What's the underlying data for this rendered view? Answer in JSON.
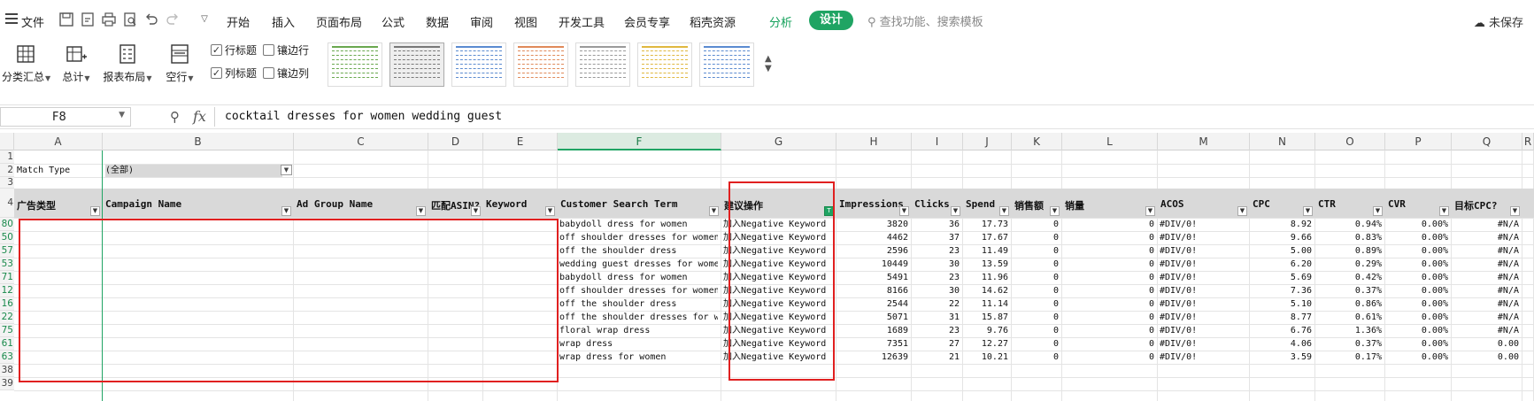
{
  "menubar": {
    "file": "文件",
    "tabs": [
      "开始",
      "插入",
      "页面布局",
      "公式",
      "数据",
      "审阅",
      "视图",
      "开发工具",
      "会员专享",
      "稻壳资源"
    ],
    "analyze": "分析",
    "design": "设计",
    "search_placeholder": "查找功能、搜索模板",
    "unsaved": "未保存"
  },
  "ribbon": {
    "subtotal": "分类汇总",
    "grand_total": "总计",
    "report_layout": "报表布局",
    "blank_rows": "空行",
    "row_headers": "行标题",
    "banded_rows": "镶边行",
    "col_headers": "列标题",
    "banded_cols": "镶边列",
    "row_headers_checked": true,
    "col_headers_checked": true,
    "style_colors": [
      "#6aa84f",
      "#777777",
      "#5b8bd0",
      "#e08a5a",
      "#9a9a9a",
      "#e0b840",
      "#5b8bd0"
    ]
  },
  "formulabar": {
    "cell_ref": "F8",
    "fx": "fx",
    "value": "cocktail dresses for women wedding guest"
  },
  "sheet": {
    "columns": [
      "A",
      "B",
      "C",
      "D",
      "E",
      "F",
      "G",
      "H",
      "I",
      "J",
      "K",
      "L",
      "M",
      "N",
      "O",
      "P",
      "Q",
      "R"
    ],
    "active_column": "F",
    "filter_label": "Match Type",
    "filter_value": "(全部)",
    "headers": [
      "广告类型",
      "Campaign Name",
      "Ad Group Name",
      "匹配ASIN?",
      "Keyword",
      "Customer Search Term",
      "建议操作",
      "Impressions",
      "Clicks",
      "Spend",
      "销售额",
      "销量",
      "ACOS",
      "CPC",
      "CTR",
      "CVR",
      "目标CPC?"
    ],
    "top_rows": [
      "1",
      "2",
      "3",
      "4"
    ],
    "data_row_labels": [
      "80",
      "50",
      "57",
      "53",
      "71",
      "12",
      "16",
      "22",
      "75",
      "61",
      "63",
      "38",
      "39"
    ],
    "rows": [
      {
        "term": "babydoll dress for women",
        "action": "加入Negative Keyword",
        "impressions": "3820",
        "clicks": "36",
        "spend": "17.73",
        "sales": "0",
        "units": "0",
        "acos": "#DIV/0!",
        "cpc": "8.92",
        "ctr": "0.94%",
        "cvr": "0.00%",
        "target": "#N/A"
      },
      {
        "term": "off shoulder dresses for women",
        "action": "加入Negative Keyword",
        "impressions": "4462",
        "clicks": "37",
        "spend": "17.67",
        "sales": "0",
        "units": "0",
        "acos": "#DIV/0!",
        "cpc": "9.66",
        "ctr": "0.83%",
        "cvr": "0.00%",
        "target": "#N/A"
      },
      {
        "term": "off the shoulder dress",
        "action": "加入Negative Keyword",
        "impressions": "2596",
        "clicks": "23",
        "spend": "11.49",
        "sales": "0",
        "units": "0",
        "acos": "#DIV/0!",
        "cpc": "5.00",
        "ctr": "0.89%",
        "cvr": "0.00%",
        "target": "#N/A"
      },
      {
        "term": "wedding guest dresses for women",
        "action": "加入Negative Keyword",
        "impressions": "10449",
        "clicks": "30",
        "spend": "13.59",
        "sales": "0",
        "units": "0",
        "acos": "#DIV/0!",
        "cpc": "6.20",
        "ctr": "0.29%",
        "cvr": "0.00%",
        "target": "#N/A"
      },
      {
        "term": "babydoll dress for women",
        "action": "加入Negative Keyword",
        "impressions": "5491",
        "clicks": "23",
        "spend": "11.96",
        "sales": "0",
        "units": "0",
        "acos": "#DIV/0!",
        "cpc": "5.69",
        "ctr": "0.42%",
        "cvr": "0.00%",
        "target": "#N/A"
      },
      {
        "term": "off shoulder dresses for women",
        "action": "加入Negative Keyword",
        "impressions": "8166",
        "clicks": "30",
        "spend": "14.62",
        "sales": "0",
        "units": "0",
        "acos": "#DIV/0!",
        "cpc": "7.36",
        "ctr": "0.37%",
        "cvr": "0.00%",
        "target": "#N/A"
      },
      {
        "term": "off the shoulder dress",
        "action": "加入Negative Keyword",
        "impressions": "2544",
        "clicks": "22",
        "spend": "11.14",
        "sales": "0",
        "units": "0",
        "acos": "#DIV/0!",
        "cpc": "5.10",
        "ctr": "0.86%",
        "cvr": "0.00%",
        "target": "#N/A"
      },
      {
        "term": "off the shoulder dresses for women",
        "action": "加入Negative Keyword",
        "impressions": "5071",
        "clicks": "31",
        "spend": "15.87",
        "sales": "0",
        "units": "0",
        "acos": "#DIV/0!",
        "cpc": "8.77",
        "ctr": "0.61%",
        "cvr": "0.00%",
        "target": "#N/A"
      },
      {
        "term": "floral wrap dress",
        "action": "加入Negative Keyword",
        "impressions": "1689",
        "clicks": "23",
        "spend": "9.76",
        "sales": "0",
        "units": "0",
        "acos": "#DIV/0!",
        "cpc": "6.76",
        "ctr": "1.36%",
        "cvr": "0.00%",
        "target": "#N/A"
      },
      {
        "term": "wrap dress",
        "action": "加入Negative Keyword",
        "impressions": "7351",
        "clicks": "27",
        "spend": "12.27",
        "sales": "0",
        "units": "0",
        "acos": "#DIV/0!",
        "cpc": "4.06",
        "ctr": "0.37%",
        "cvr": "0.00%",
        "target": "0.00"
      },
      {
        "term": "wrap dress for women",
        "action": "加入Negative Keyword",
        "impressions": "12639",
        "clicks": "21",
        "spend": "10.21",
        "sales": "0",
        "units": "0",
        "acos": "#DIV/0!",
        "cpc": "3.59",
        "ctr": "0.17%",
        "cvr": "0.00%",
        "target": "0.00"
      }
    ]
  },
  "highlight_color": "#e02020",
  "accent_color": "#1fa463"
}
